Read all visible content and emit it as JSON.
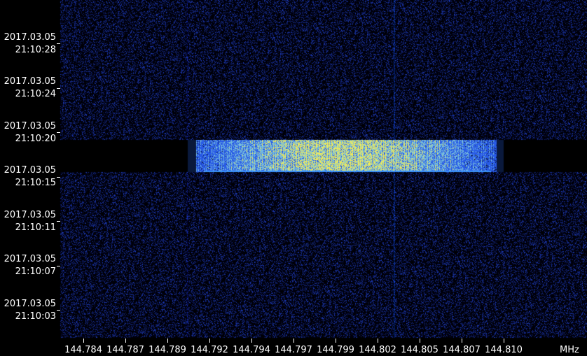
{
  "spectrogram": {
    "background_color": "#000000",
    "noise_color": "#1d2fa8",
    "signal_color_low": "#2a5cff",
    "signal_color_high": "#f4f060",
    "unit": "MHz",
    "frequency_labels": [
      "144.784",
      "144.787",
      "144.789",
      "144.792",
      "144.794",
      "144.797",
      "144.799",
      "144.802",
      "144.805",
      "144.807",
      "144.810"
    ],
    "time_labels": [
      {
        "date": "2017.03.05",
        "time": "21:10:28"
      },
      {
        "date": "2017.03.05",
        "time": "21:10:24"
      },
      {
        "date": "2017.03.05",
        "time": "21:10:20"
      },
      {
        "date": "2017.03.05",
        "time": "21:10:15"
      },
      {
        "date": "2017.03.05",
        "time": "21:10:11"
      },
      {
        "date": "2017.03.05",
        "time": "21:10:07"
      },
      {
        "date": "2017.03.05",
        "time": "21:10:03"
      }
    ]
  }
}
